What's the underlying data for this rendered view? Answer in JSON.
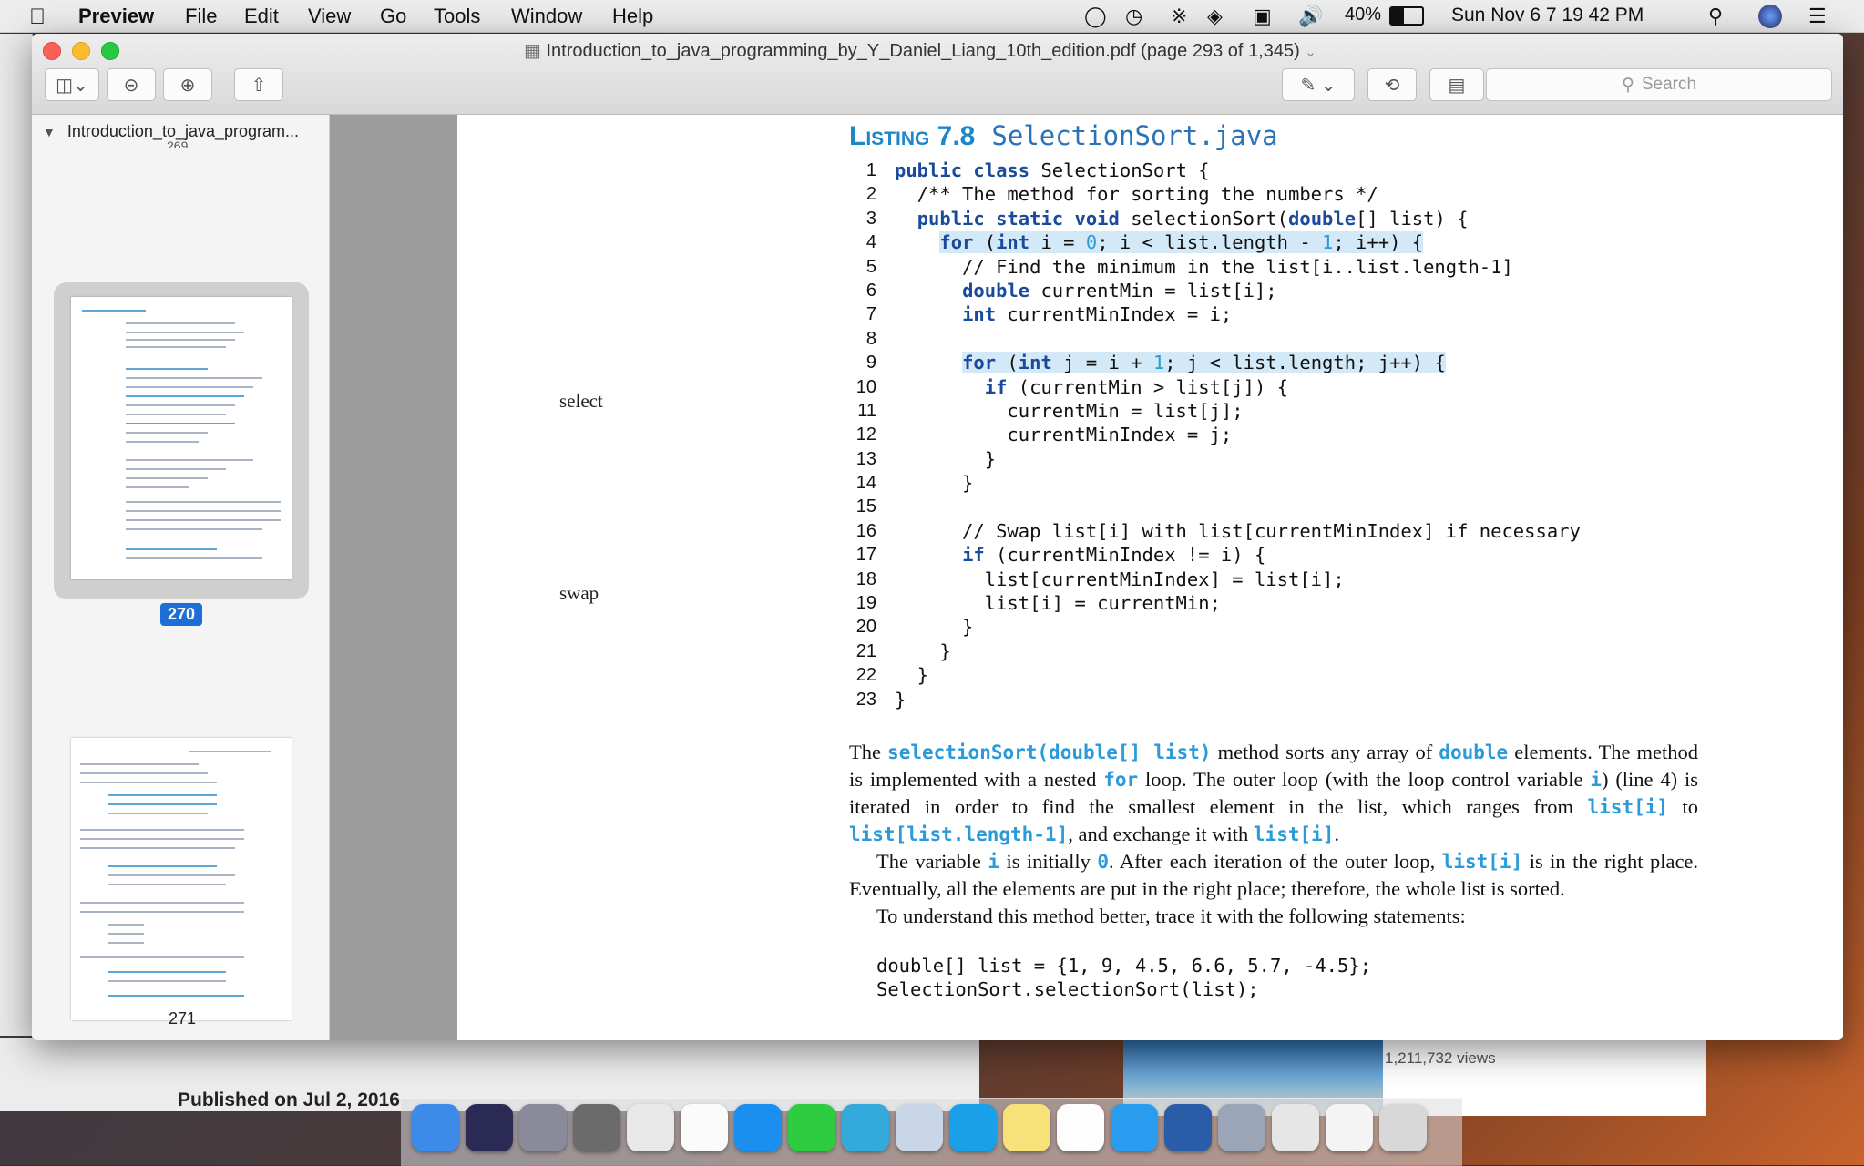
{
  "menubar": {
    "app": "Preview",
    "items": [
      "File",
      "Edit",
      "View",
      "Go",
      "Tools",
      "Window",
      "Help"
    ],
    "battery": "40%",
    "clock": "Sun Nov 6  7 19 42 PM"
  },
  "window": {
    "title": "Introduction_to_java_programming_by_Y_Daniel_Liang_10th_edition.pdf (page 293 of 1,345)",
    "search_placeholder": "Search"
  },
  "sidebar": {
    "title": "Introduction_to_java_program...",
    "page_fragment": "269",
    "pages": [
      {
        "label": "270",
        "selected": true
      },
      {
        "label": "271",
        "selected": false
      }
    ]
  },
  "document": {
    "listing_label": "Listing 7.8",
    "listing_file": "SelectionSort.java",
    "margin_notes": {
      "select": "select",
      "swap": "swap"
    },
    "prose1_a": "The",
    "prose1_code1": "selectionSort(double[] list)",
    "prose1_b": "method sorts any array of",
    "prose1_code2": "double",
    "prose1_c": "elements. The method is implemented with a nested",
    "prose1_code3": "for",
    "prose1_d": "loop. The outer loop (with the loop control variable",
    "prose1_code4": "i",
    "prose1_e": ") (line 4) is iterated in order to find the smallest element in the list, which ranges from",
    "prose1_code5": "list[i]",
    "prose1_f": "to",
    "prose1_code6": "list[list.length-1]",
    "prose1_g": ", and exchange it with",
    "prose1_code7": "list[i]",
    "prose1_h": ".",
    "prose2_a": "The variable",
    "prose2_code1": "i",
    "prose2_b": "is initially",
    "prose2_code2": "0",
    "prose2_c": ". After each iteration of the outer loop,",
    "prose2_code3": "list[i]",
    "prose2_d": "is in the right place. Eventually, all the elements are put in the right place; therefore, the whole list is sorted.",
    "prose3": "To understand this method better, trace it with the following statements:",
    "example_line1": "double[] list = {1, 9, 4.5, 6.6, 5.7, -4.5};",
    "example_line2": "SelectionSort.selectionSort(list);"
  },
  "code_lines": [
    {
      "n": "1",
      "t": "public class SelectionSort {"
    },
    {
      "n": "2",
      "t": "  /** The method for sorting the numbers */"
    },
    {
      "n": "3",
      "t": "  public static void selectionSort(double[] list) {"
    },
    {
      "n": "4",
      "t": "    for (int i = 0; i < list.length - 1; i++) {"
    },
    {
      "n": "5",
      "t": "      // Find the minimum in the list[i..list.length-1]"
    },
    {
      "n": "6",
      "t": "      double currentMin = list[i];"
    },
    {
      "n": "7",
      "t": "      int currentMinIndex = i;"
    },
    {
      "n": "8",
      "t": ""
    },
    {
      "n": "9",
      "t": "      for (int j = i + 1; j < list.length; j++) {"
    },
    {
      "n": "10",
      "t": "        if (currentMin > list[j]) {"
    },
    {
      "n": "11",
      "t": "          currentMin = list[j];"
    },
    {
      "n": "12",
      "t": "          currentMinIndex = j;"
    },
    {
      "n": "13",
      "t": "        }"
    },
    {
      "n": "14",
      "t": "      }"
    },
    {
      "n": "15",
      "t": ""
    },
    {
      "n": "16",
      "t": "      // Swap list[i] with list[currentMinIndex] if necessary"
    },
    {
      "n": "17",
      "t": "      if (currentMinIndex != i) {"
    },
    {
      "n": "18",
      "t": "        list[currentMinIndex] = list[i];"
    },
    {
      "n": "19",
      "t": "        list[i] = currentMin;"
    },
    {
      "n": "20",
      "t": "      }"
    },
    {
      "n": "21",
      "t": "    }"
    },
    {
      "n": "22",
      "t": "  }"
    },
    {
      "n": "23",
      "t": "}"
    }
  ],
  "background": {
    "published": "Published on Jul 2, 2016",
    "views": "1,211,732 views"
  },
  "dock_apps": [
    "Finder",
    "Siri",
    "Launchpad",
    "System Preferences",
    "Chrome",
    "iTunes",
    "App Store",
    "FaceTime",
    "Messages",
    "Preview",
    "Skype",
    "Notes",
    "Photos",
    "Safari",
    "Word",
    "Image Capture",
    "Document",
    "TextEdit",
    "Trash"
  ]
}
